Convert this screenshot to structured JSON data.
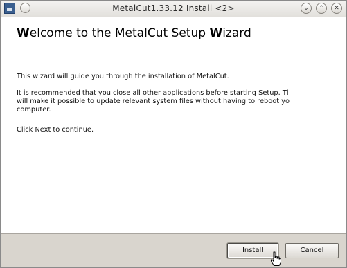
{
  "window": {
    "title": "MetalCut1.33.12 Install <2>"
  },
  "titlebar_buttons": {
    "minimize_glyph": "⌄",
    "maximize_glyph": "⌃",
    "close_glyph": "✕"
  },
  "main": {
    "heading_parts": [
      "W",
      "elcome to the MetalCut Setup ",
      "W",
      "izard"
    ],
    "paragraphs": [
      "This wizard will guide you through the installation of MetalCut.",
      "It is recommended that you close all other applications before starting Setup. Tl",
      "will make it possible to update relevant system files without having to reboot yo",
      "computer.",
      "Click Next to continue."
    ]
  },
  "footer": {
    "install_label": "Install",
    "cancel_label": "Cancel"
  },
  "icons": {
    "app": "installer-app-icon",
    "cursor": "hand-pointer-icon"
  }
}
